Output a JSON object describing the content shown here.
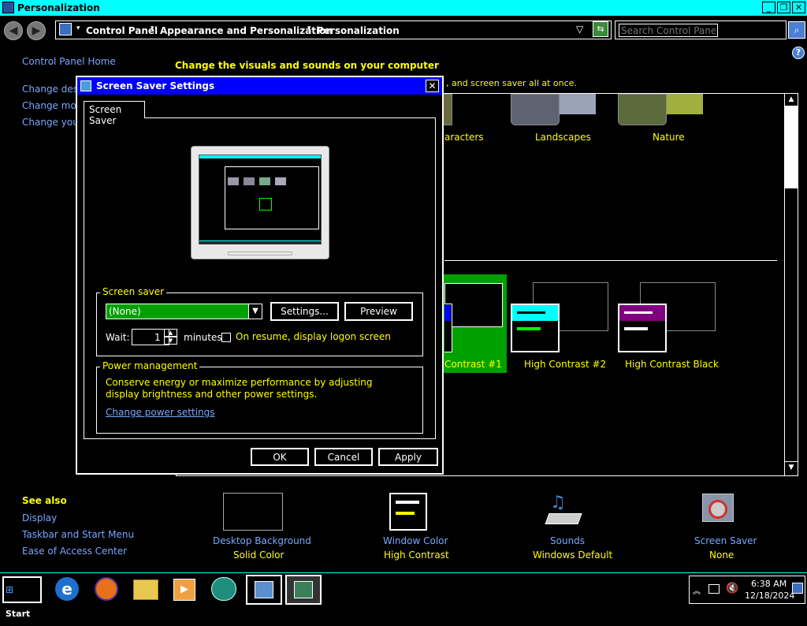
{
  "window": {
    "title": "Personalization"
  },
  "address": {
    "crumbs": [
      "Control Panel",
      "Appearance and Personalization",
      "Personalization"
    ],
    "search_placeholder": "Search Control Panel"
  },
  "left_nav": {
    "home": "Control Panel Home",
    "items": [
      "Change deskto",
      "Change mouse",
      "Change your a"
    ]
  },
  "main": {
    "heading": "Change the visuals and sounds on your computer",
    "subtext": ", and screen saver all at once.",
    "themes_top": [
      "aracters",
      "Landscapes",
      "Nature"
    ],
    "themes_hc": [
      "Contrast #1",
      "High Contrast #2",
      "High Contrast Black"
    ]
  },
  "see_also": {
    "title": "See also",
    "links": [
      "Display",
      "Taskbar and Start Menu",
      "Ease of Access Center"
    ]
  },
  "bottom_items": [
    {
      "label": "Desktop Background",
      "value": "Solid Color"
    },
    {
      "label": "Window Color",
      "value": "High Contrast"
    },
    {
      "label": "Sounds",
      "value": "Windows Default"
    },
    {
      "label": "Screen Saver",
      "value": "None"
    }
  ],
  "dialog": {
    "title": "Screen Saver Settings",
    "tab": "Screen Saver",
    "screen_saver_group": "Screen saver",
    "selected": "(None)",
    "settings_btn": "Settings...",
    "preview_btn": "Preview",
    "wait_label": "Wait:",
    "wait_value": "1",
    "minutes_label": "minutes",
    "resume_label": "On resume, display logon screen",
    "power_group": "Power management",
    "power_text": "Conserve energy or maximize performance by adjusting display brightness and other power settings.",
    "power_link": "Change power settings",
    "ok": "OK",
    "cancel": "Cancel",
    "apply": "Apply"
  },
  "taskbar": {
    "start": "Start",
    "time": "6:38 AM",
    "date": "12/18/2024"
  },
  "colors": {
    "cyan": "#00ffff",
    "yellow": "#ffff00",
    "green": "#00a000",
    "link": "#7aa6ff",
    "blue_title": "#0000ff"
  }
}
